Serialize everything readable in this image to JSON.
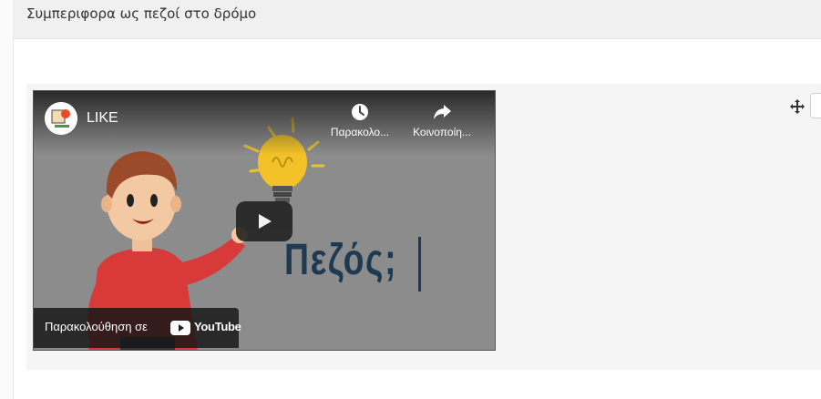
{
  "page": {
    "title": "Συμπεριφορα ως πεζοί στο δρόμο"
  },
  "video": {
    "channel_name": "LIKE",
    "watch_later_label": "Παρακολο...",
    "share_label": "Κοινοποίη...",
    "watch_on_label": "Παρακολούθηση σε",
    "youtube_label": "YouTube",
    "thumbnail_text": "Πεζός;"
  },
  "colors": {
    "title_bar_bg": "#f0f0f0",
    "content_bg": "#f5f5f5",
    "video_bg": "#8a8a8a",
    "pezos_text": "#1e3a52",
    "youtube_red": "#ff0000"
  },
  "icons": [
    "move-icon",
    "clock-icon",
    "share-icon",
    "play-icon",
    "youtube-logo-icon"
  ]
}
